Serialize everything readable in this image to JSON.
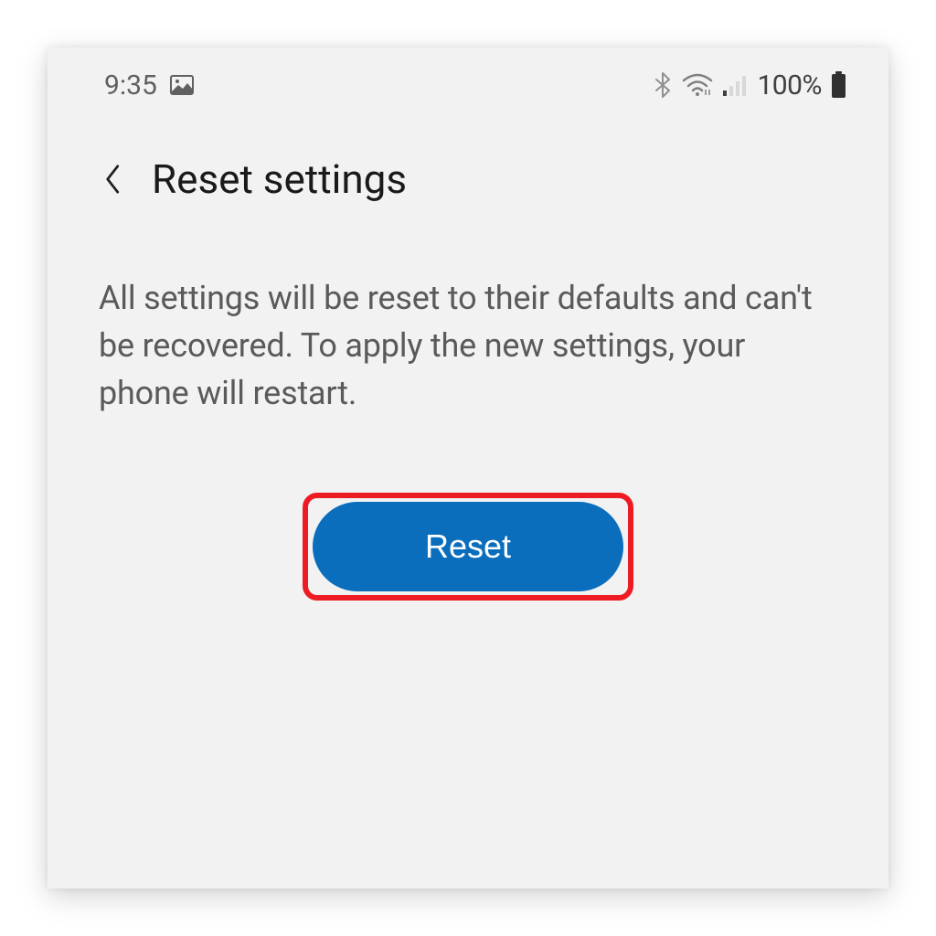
{
  "status_bar": {
    "time": "9:35",
    "battery_percent": "100%"
  },
  "header": {
    "title": "Reset settings"
  },
  "body": {
    "description": "All settings will be reset to their defaults and can't be recovered. To apply the new settings, your phone will restart."
  },
  "actions": {
    "reset_label": "Reset"
  },
  "annotation": {
    "highlight_color": "#ed1c24"
  },
  "colors": {
    "button_bg": "#0a6ebd",
    "text_primary": "#1a1a1a",
    "text_secondary": "#5a5a5a"
  }
}
